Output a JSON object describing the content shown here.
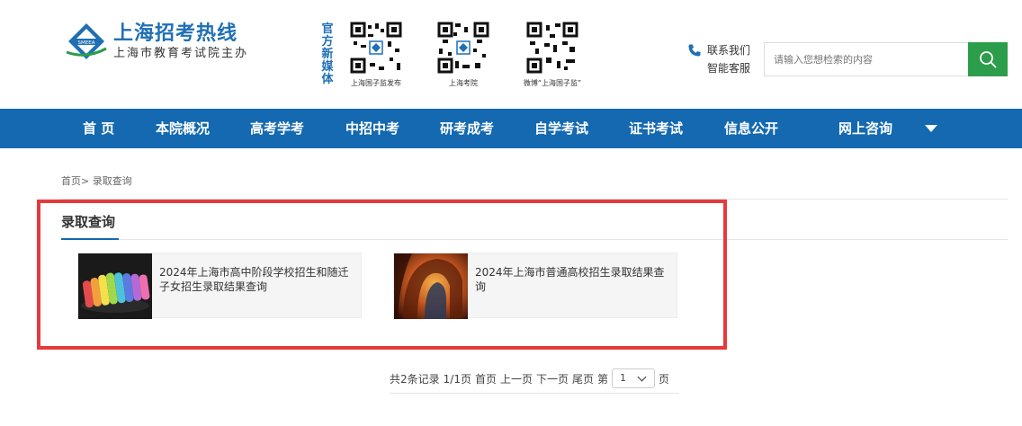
{
  "header": {
    "logo_title": "上海招考热线",
    "logo_sub": "上海市教育考试院主办",
    "logo_badge": "SMEEA",
    "official_media": "官方新媒体",
    "qr_codes": [
      {
        "caption": "上海国子监发布"
      },
      {
        "caption": "上海考院"
      },
      {
        "caption": "微博“上海国子监”"
      }
    ],
    "contact": "联系我们",
    "smart_service": "智能客服",
    "search_placeholder": "请输入您想检索的内容"
  },
  "nav": {
    "items": [
      "首 页",
      "本院概况",
      "高考学考",
      "中招中考",
      "研考成考",
      "自学考试",
      "证书考试",
      "信息公开",
      "网上咨询"
    ]
  },
  "breadcrumb": {
    "home": "首页>",
    "current": "录取查询"
  },
  "section": {
    "title": "录取查询",
    "cards": [
      {
        "text": "2024年上海市高中阶段学校招生和随迁子女招生录取结果查询"
      },
      {
        "text": "2024年上海市普通高校招生录取结果查询"
      }
    ]
  },
  "pager": {
    "total": "共2条记录",
    "pages": "1/1页",
    "first": "首页",
    "prev": "上一页",
    "next": "下一页",
    "last": "尾页",
    "page_prefix": "第",
    "page_value": "1",
    "page_suffix": "页"
  },
  "colors": {
    "brand_blue": "#1469b0",
    "search_green": "#2c9d4a",
    "highlight_red": "#e53a3d"
  }
}
